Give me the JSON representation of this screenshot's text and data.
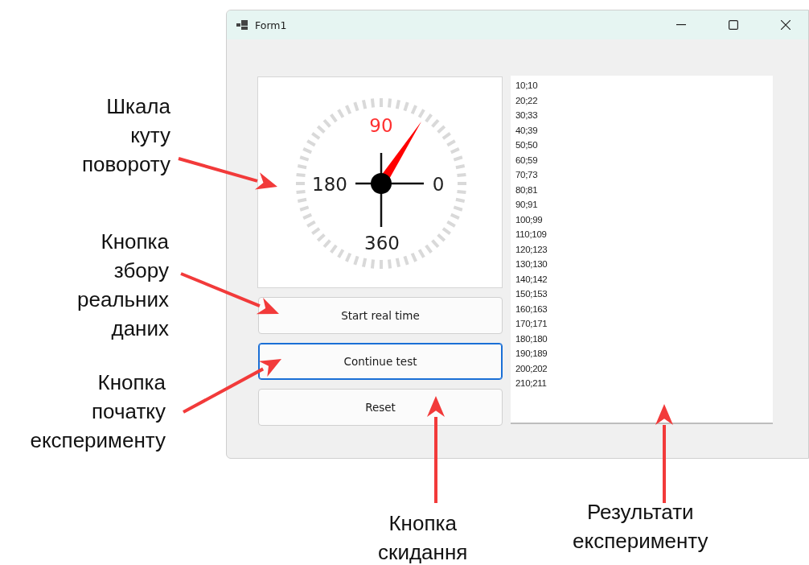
{
  "window": {
    "title": "Form1"
  },
  "gauge": {
    "labels": [
      {
        "text": "90",
        "highlighted": true
      },
      {
        "text": "180",
        "highlighted": false
      },
      {
        "text": "0",
        "highlighted": false
      },
      {
        "text": "360",
        "highlighted": false
      }
    ]
  },
  "buttons": [
    {
      "label": "Start real time",
      "focused": false
    },
    {
      "label": "Continue test",
      "focused": true
    },
    {
      "label": "Reset",
      "focused": false
    }
  ],
  "results": [
    "10;10",
    "20;22",
    "30;33",
    "40;39",
    "50;50",
    "60;59",
    "70;73",
    "80;81",
    "90;91",
    "100;99",
    "110;109",
    "120;123",
    "130;130",
    "140;142",
    "150;153",
    "160;163",
    "170;171",
    "180;180",
    "190;189",
    "200;202",
    "210;211"
  ],
  "annotations": [
    "Шкала\nкуту\nповороту",
    "Кнопка\nзбору\nреальних\nданих",
    "Кнопка\nпочатку\nексперименту",
    "Кнопка\nскидання",
    "Результати\nексперименту"
  ]
}
